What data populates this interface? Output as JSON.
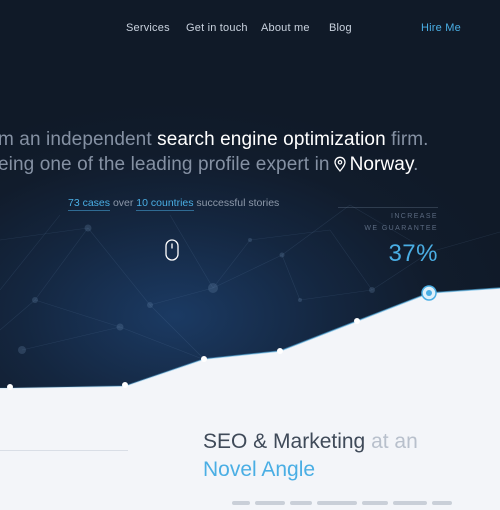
{
  "nav": {
    "items": [
      "Services",
      "Get in touch",
      "About me",
      "Blog"
    ],
    "cta": "Hire Me"
  },
  "hero": {
    "line1_pre": "m an independent ",
    "line1_em": "search engine optimization",
    "line1_post": " firm.",
    "line2_pre": "eing one of the leading profile expert in",
    "line2_location": "Norway",
    "line2_post": ".",
    "stats": {
      "cases": "73 cases",
      "between": " over ",
      "countries": "10 countries",
      "suffix": " successful stories"
    },
    "increase": {
      "label_line1": "INCREASE",
      "label_line2": "WE GUARANTEE",
      "value": "37%"
    }
  },
  "section": {
    "title_main": "SEO & Marketing",
    "title_muted": " at an",
    "title_accent": "Novel Angle"
  },
  "colors": {
    "accent": "#4aaee4",
    "hero_bg": "#111c2c",
    "page_bg": "#f3f5f9"
  },
  "icons": [
    "location-pin-icon",
    "mouse-scroll-icon"
  ]
}
